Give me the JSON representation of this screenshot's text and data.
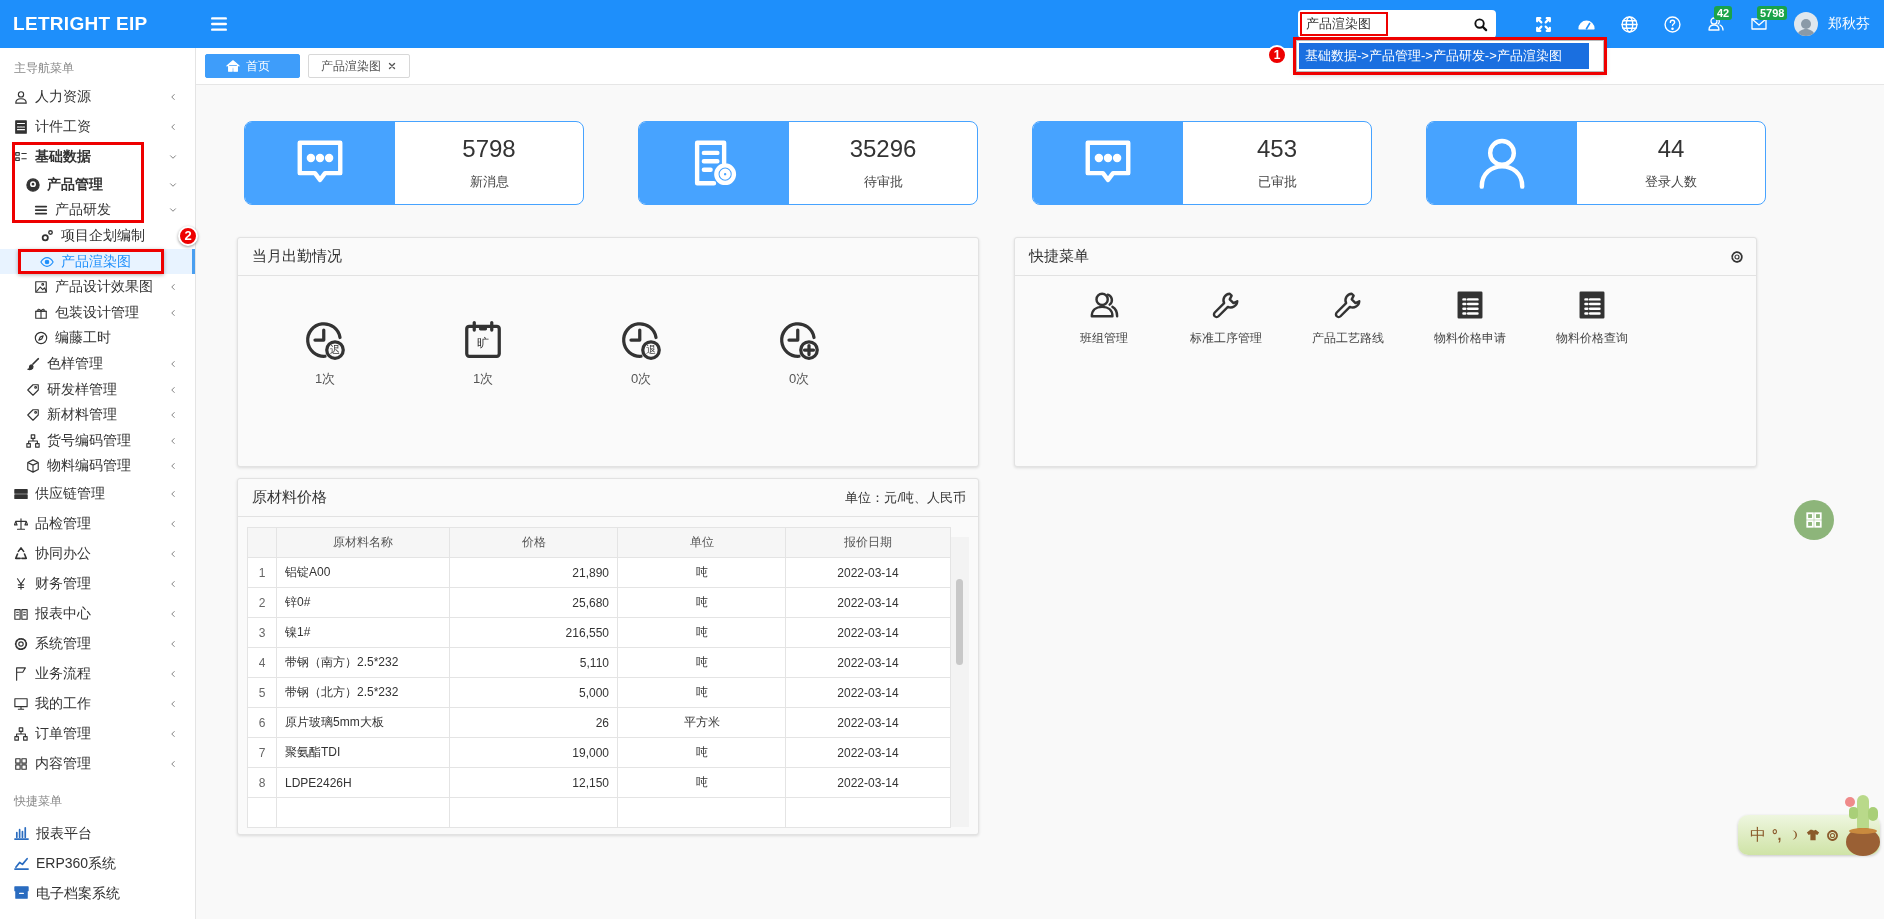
{
  "topbar": {
    "logo": "LETRIGHT EIP",
    "search": {
      "value": "产品渲染图",
      "framed": true
    },
    "dropdown": {
      "items": [
        {
          "text": "基础数据->产品管理->产品研发->产品渲染图",
          "selected": true
        }
      ],
      "framed": true,
      "marker": "1"
    },
    "badges": [
      {
        "count": "42"
      },
      {
        "count": "5798"
      }
    ],
    "user": "郑秋芬"
  },
  "sidebar": {
    "header": "主导航菜单",
    "items": [
      {
        "label": "人力资源",
        "submenu": true,
        "expanded": false
      },
      {
        "label": "计件工资",
        "submenu": true,
        "expanded": false
      },
      {
        "label": "基础数据",
        "submenu": true,
        "expanded": true,
        "framed": true,
        "children": [
          {
            "label": "产品管理",
            "submenu": true,
            "expanded": true,
            "framed": true,
            "children": [
              {
                "label": "产品研发",
                "submenu": true,
                "expanded": true,
                "framed": true,
                "children": [
                  {
                    "label": "项目企划编制",
                    "submenu": false,
                    "selected": false
                  },
                  {
                    "label": "产品渲染图",
                    "submenu": false,
                    "selected": true,
                    "framed": true,
                    "marker": "2"
                  }
                ]
              },
              {
                "label": "产品设计效果图",
                "submenu": true,
                "expanded": false
              },
              {
                "label": "包装设计管理",
                "submenu": true,
                "expanded": false
              },
              {
                "label": "编藤工时",
                "submenu": false,
                "selected": false
              }
            ]
          },
          {
            "label": "色样管理",
            "submenu": true,
            "expanded": false
          },
          {
            "label": "研发样管理",
            "submenu": true,
            "expanded": false
          },
          {
            "label": "新材料管理",
            "submenu": true,
            "expanded": false
          },
          {
            "label": "货号编码管理",
            "submenu": true,
            "expanded": false
          },
          {
            "label": "物料编码管理",
            "submenu": true,
            "expanded": false
          }
        ]
      },
      {
        "label": "供应链管理",
        "submenu": true,
        "expanded": false
      },
      {
        "label": "品检管理",
        "submenu": true,
        "expanded": false
      },
      {
        "label": "协同办公",
        "submenu": true,
        "expanded": false
      },
      {
        "label": "财务管理",
        "submenu": true,
        "expanded": false
      },
      {
        "label": "报表中心",
        "submenu": true,
        "expanded": false
      },
      {
        "label": "系统管理",
        "submenu": true,
        "expanded": false
      },
      {
        "label": "业务流程",
        "submenu": true,
        "expanded": false
      },
      {
        "label": "我的工作",
        "submenu": true,
        "expanded": false
      },
      {
        "label": "订单管理",
        "submenu": true,
        "expanded": false
      },
      {
        "label": "内容管理",
        "submenu": true,
        "expanded": false
      }
    ],
    "quick_header": "快捷菜单",
    "quick_links": [
      {
        "label": "报表平台"
      },
      {
        "label": "ERP360系统"
      },
      {
        "label": "电子档案系统"
      }
    ]
  },
  "tabs": [
    {
      "label": "首页",
      "selected": true,
      "closable": false
    },
    {
      "label": "产品渲染图",
      "selected": false,
      "closable": true
    }
  ],
  "stats": [
    {
      "kind": "chat",
      "value": "5798",
      "label": "新消息"
    },
    {
      "kind": "document",
      "value": "35296",
      "label": "待审批"
    },
    {
      "kind": "chat",
      "value": "453",
      "label": "已审批"
    },
    {
      "kind": "person",
      "value": "44",
      "label": "登录人数"
    }
  ],
  "attendance": {
    "title": "当月出勤情况",
    "items": [
      {
        "kind": "clock",
        "mark": "迟",
        "count": "1次"
      },
      {
        "kind": "calendar",
        "mark": "旷",
        "count": "1次"
      },
      {
        "kind": "clock",
        "mark": "退",
        "count": "0次"
      },
      {
        "kind": "clock-plus",
        "count": "0次"
      }
    ]
  },
  "quick_menu": {
    "title": "快捷菜单",
    "items": [
      {
        "kind": "users",
        "label": "班组管理"
      },
      {
        "kind": "wrench",
        "label": "标准工序管理"
      },
      {
        "kind": "wrench",
        "label": "产品工艺路线"
      },
      {
        "kind": "list",
        "label": "物料价格申请"
      },
      {
        "kind": "list",
        "label": "物料价格查询"
      }
    ]
  },
  "prices": {
    "title": "原材料价格",
    "unit_note": "单位：元/吨、人民币",
    "columns": [
      "原材料名称",
      "价格",
      "单位",
      "报价日期"
    ],
    "rows": [
      {
        "no": "1",
        "name": "铝锭A00",
        "price": "21,890",
        "unit": "吨",
        "date": "2022-03-14"
      },
      {
        "no": "2",
        "name": "锌0#",
        "price": "25,680",
        "unit": "吨",
        "date": "2022-03-14"
      },
      {
        "no": "3",
        "name": "镍1#",
        "price": "216,550",
        "unit": "吨",
        "date": "2022-03-14"
      },
      {
        "no": "4",
        "name": "带钢（南方）2.5*232",
        "price": "5,110",
        "unit": "吨",
        "date": "2022-03-14"
      },
      {
        "no": "5",
        "name": "带钢（北方）2.5*232",
        "price": "5,000",
        "unit": "吨",
        "date": "2022-03-14"
      },
      {
        "no": "6",
        "name": "原片玻璃5mm大板",
        "price": "26",
        "unit": "平方米",
        "date": "2022-03-14"
      },
      {
        "no": "7",
        "name": "聚氨酯TDI",
        "price": "19,000",
        "unit": "吨",
        "date": "2022-03-14"
      },
      {
        "no": "8",
        "name": "LDPE2426H",
        "price": "12,150",
        "unit": "吨",
        "date": "2022-03-14"
      }
    ]
  },
  "ime_toolbar": {
    "mode": "中",
    "punctuation": "°,"
  }
}
